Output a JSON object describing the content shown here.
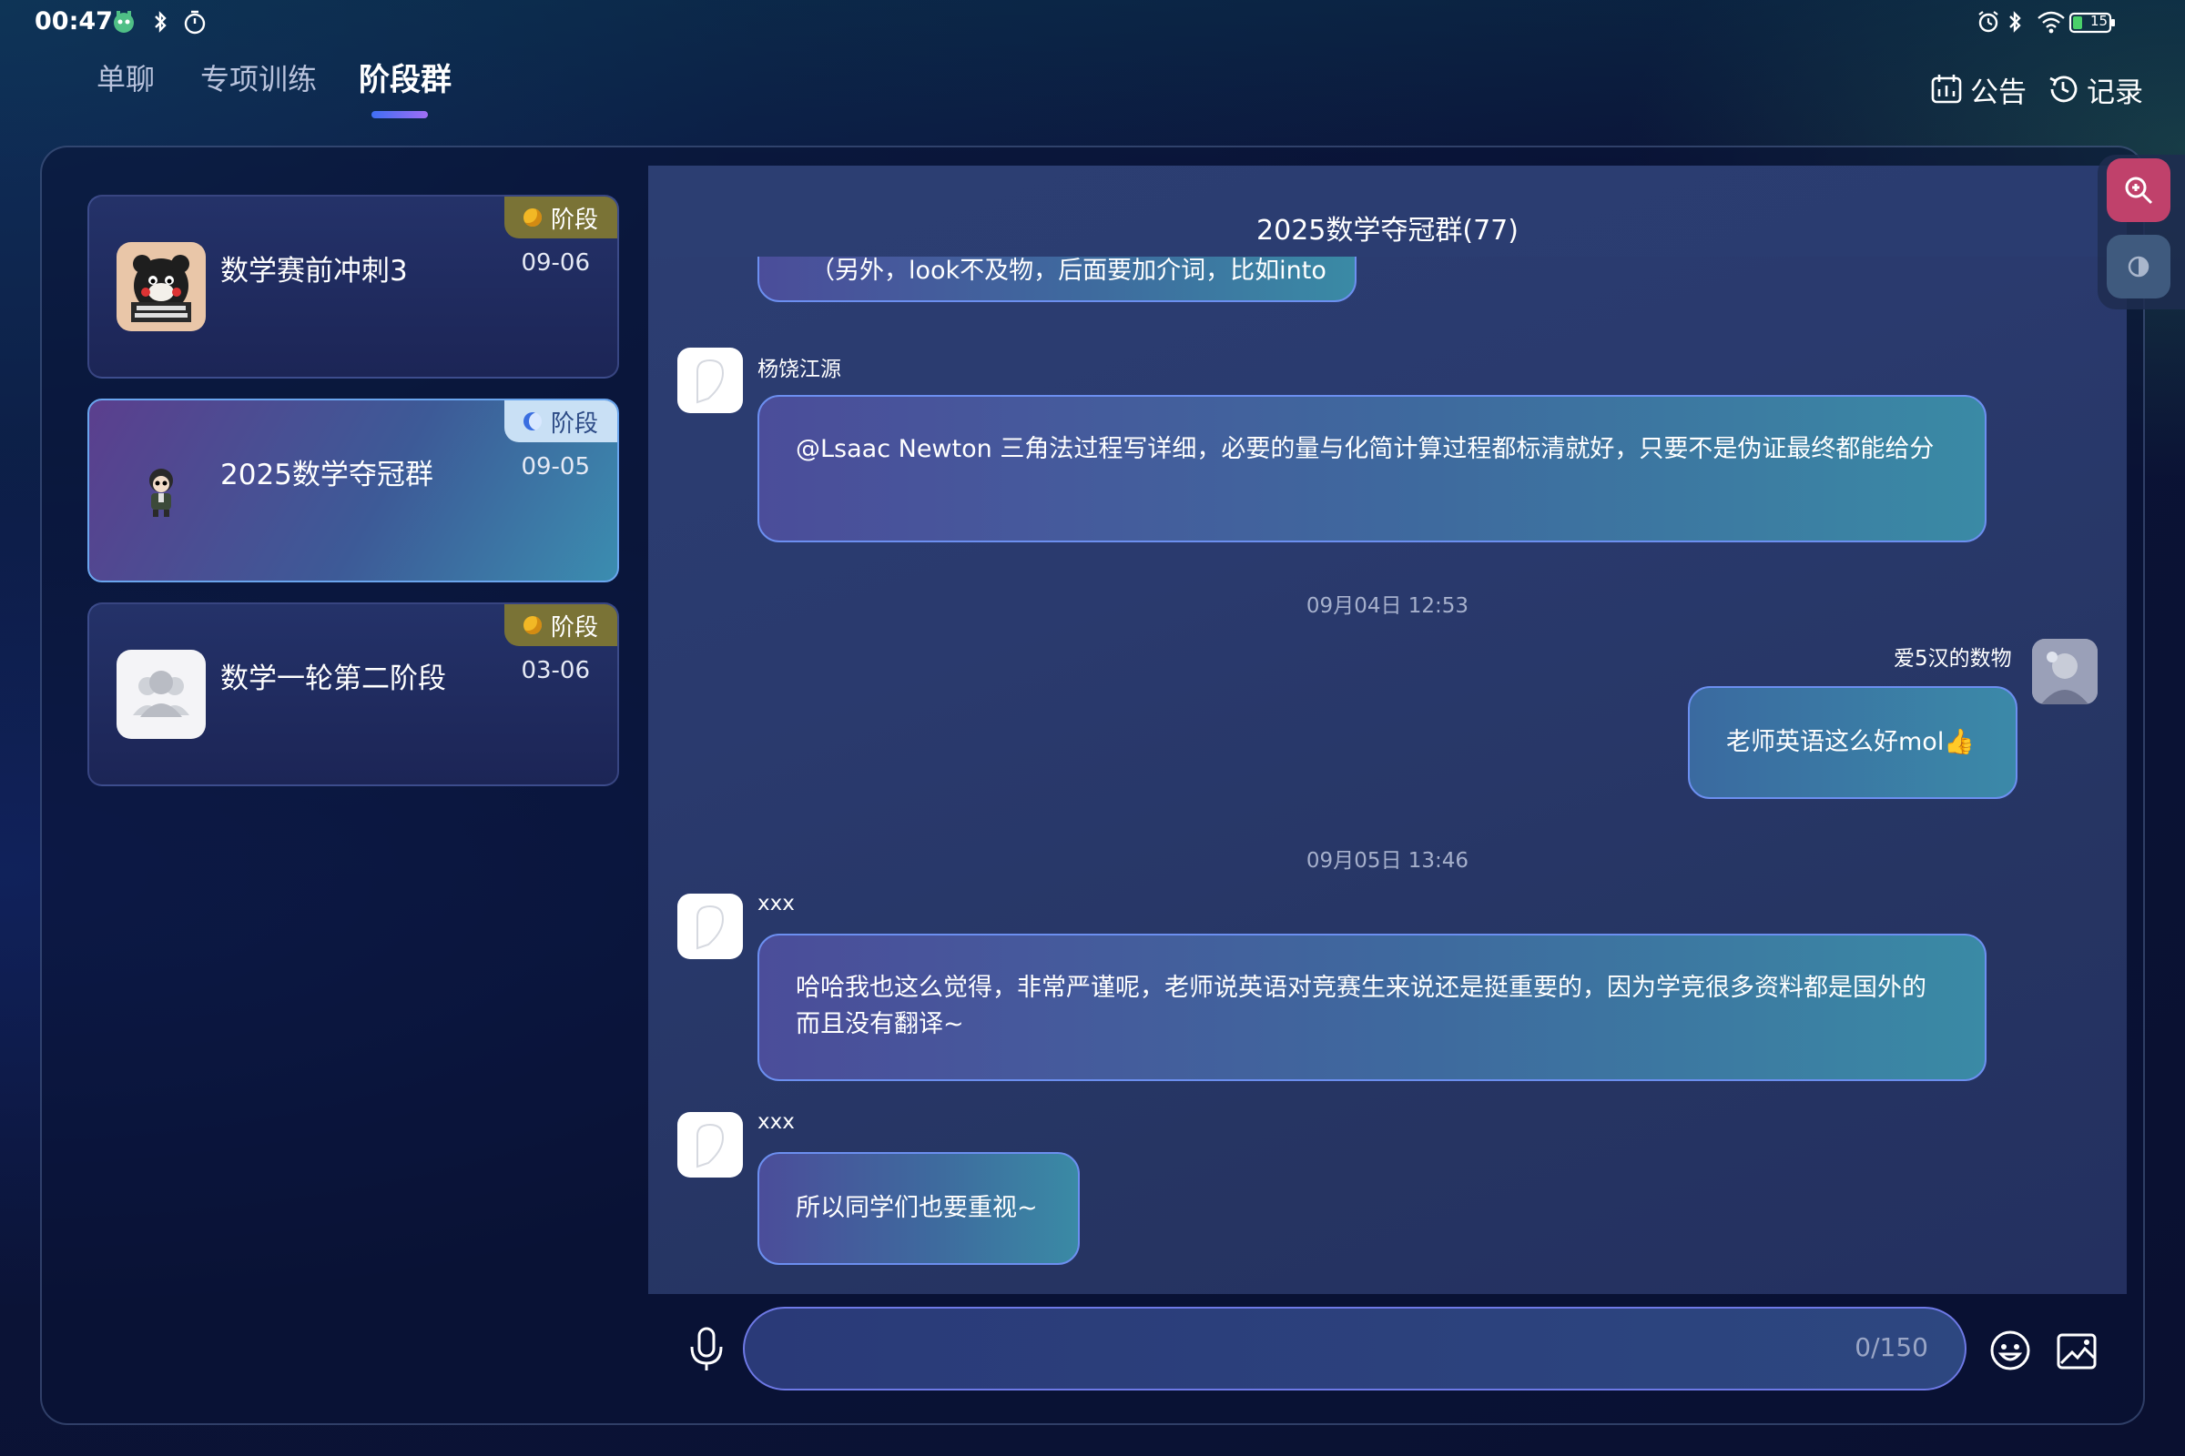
{
  "status_bar": {
    "time": "00:47",
    "battery": "15"
  },
  "tabs": [
    {
      "label": "单聊",
      "active": false
    },
    {
      "label": "专项训练",
      "active": false
    },
    {
      "label": "阶段群",
      "active": true
    }
  ],
  "header_actions": {
    "announcement": "公告",
    "records": "记录"
  },
  "conversations": [
    {
      "name": "数学赛前冲刺3",
      "date": "09-06",
      "badge": "阶段",
      "selected": false,
      "badge_dot_color": "#f2b825"
    },
    {
      "name": "2025数学夺冠群",
      "date": "09-05",
      "badge": "阶段",
      "selected": true,
      "badge_dot_color": "#3a6ee0"
    },
    {
      "name": "数学一轮第二阶段",
      "date": "03-06",
      "badge": "阶段",
      "selected": false,
      "badge_dot_color": "#f2b825"
    }
  ],
  "chat": {
    "title": "2025数学夺冠群(77)",
    "messages": [
      {
        "sender": "",
        "text": "（另外，look不及物，后面要加介词，比如into"
      },
      {
        "sender": "杨饶江源",
        "text": "@Lsaac  Newton 三角法过程写详细，必要的量与化简计算过程都标清就好，只要不是伪证最终都能给分"
      },
      {
        "time": "09月04日 12:53"
      },
      {
        "sender": "爱5汉的数物",
        "text": "老师英语这么好mol👍"
      },
      {
        "time": "09月05日 13:46"
      },
      {
        "sender": "xxx",
        "text": "哈哈我也这么觉得，非常严谨呢，老师说英语对竞赛生来说还是挺重要的，因为学竞很多资料都是国外的而且没有翻译~"
      },
      {
        "sender": "xxx",
        "text": "所以同学们也要重视~"
      }
    ]
  },
  "input": {
    "counter": "0/150"
  },
  "colors": {
    "accent": "#6c8ff0",
    "tab_underline": "#6a7ef5",
    "tool_zoom": "#c0416b"
  }
}
